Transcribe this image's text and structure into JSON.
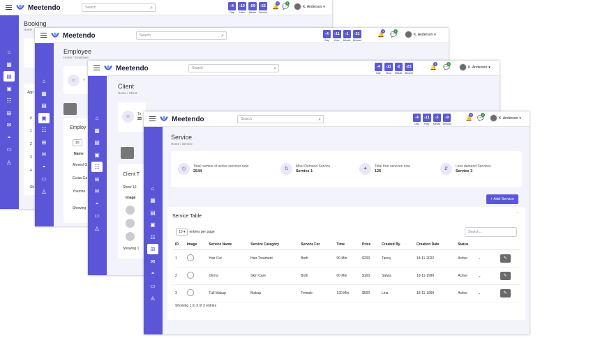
{
  "brand": {
    "name": "Meetendo",
    "accent": "#5b56d8"
  },
  "search_placeholder": "Search",
  "user_name": "K. Anderson",
  "timer_labels": {
    "day": "Day",
    "hour": "Hour",
    "minute": "Minute",
    "second": "Second"
  },
  "windows": [
    {
      "title": "Booking",
      "crumb": "Home",
      "timer": [
        "-4",
        "-10",
        "-59",
        "-53"
      ],
      "notif": [
        "4",
        "3"
      ]
    },
    {
      "title": "Employee",
      "crumb_home": "Home",
      "crumb_sep": "/",
      "crumb_page": "Employee",
      "timer": [
        "-4",
        "-11",
        "-1",
        "-21"
      ],
      "notif": [
        "4",
        "3"
      ]
    },
    {
      "title": "Client",
      "crumb_home": "Home",
      "crumb_sep": "/",
      "crumb_page": "Client",
      "timer": [
        "-4",
        "-11",
        "-2",
        "-23"
      ],
      "notif": [
        "4",
        "3"
      ]
    },
    {
      "title": "Service",
      "crumb_home": "Home",
      "crumb_sep": "/",
      "crumb_page": "Service",
      "timer": [
        "-4",
        "-11",
        "-3",
        "-9"
      ],
      "notif": [
        "4",
        "3"
      ]
    }
  ],
  "booking_partial": {
    "app_label": "App",
    "hash": "#",
    "rows": [
      "1",
      "2",
      "3",
      "4"
    ],
    "sh": "Sh"
  },
  "employee_partial": {
    "stat_t": "T",
    "table_title": "Employ",
    "entries": "10",
    "name_header": "Name",
    "rows": [
      "Ahmed G",
      "Esraa Ga",
      "Youmna"
    ],
    "showing": "Showing"
  },
  "client_partial": {
    "stat_t": "To",
    "stat_v": "25",
    "table_title": "Client T",
    "show": "Show",
    "entries": "10",
    "image_header": "Image",
    "showing": "Showing 1"
  },
  "service": {
    "stats": [
      {
        "label": "Total number of active services now",
        "value": "2544"
      },
      {
        "label": "Most Demand Service",
        "value": "Service 1"
      },
      {
        "label": "Total free services now",
        "value": "125"
      },
      {
        "label": "Less demand Services",
        "value": "Service 3"
      }
    ],
    "add_button": "+ Add Service",
    "table_title": "Service Table",
    "more": "...",
    "entries_select": "10",
    "entries_label": "entries per page",
    "search_placeholder": "Search...",
    "columns": [
      "ID",
      "Image",
      "Service Name",
      "Service Category",
      "Service For",
      "Time",
      "Price",
      "Created By",
      "Creation Date",
      "Status"
    ],
    "rows": [
      {
        "id": "1",
        "name": "Hair Cut",
        "category": "Hair Treament",
        "for": "Both",
        "time": "90 Min",
        "price": "$200",
        "by": "Tareq",
        "date": "18-11-2022",
        "status": "Active"
      },
      {
        "id": "2",
        "name": "Dirma",
        "category": "Skin Care",
        "for": "Both",
        "time": "60 Min",
        "price": "$100",
        "by": "Salwa",
        "date": "18-11-1999",
        "status": "Active"
      },
      {
        "id": "3",
        "name": "Full Makup",
        "category": "Makup",
        "for": "Female",
        "time": "120 Min",
        "price": "$500",
        "by": "Lina",
        "date": "18-11-1999",
        "status": "Active"
      }
    ],
    "footer": "Showing 1 to 3 of 3 entries"
  }
}
